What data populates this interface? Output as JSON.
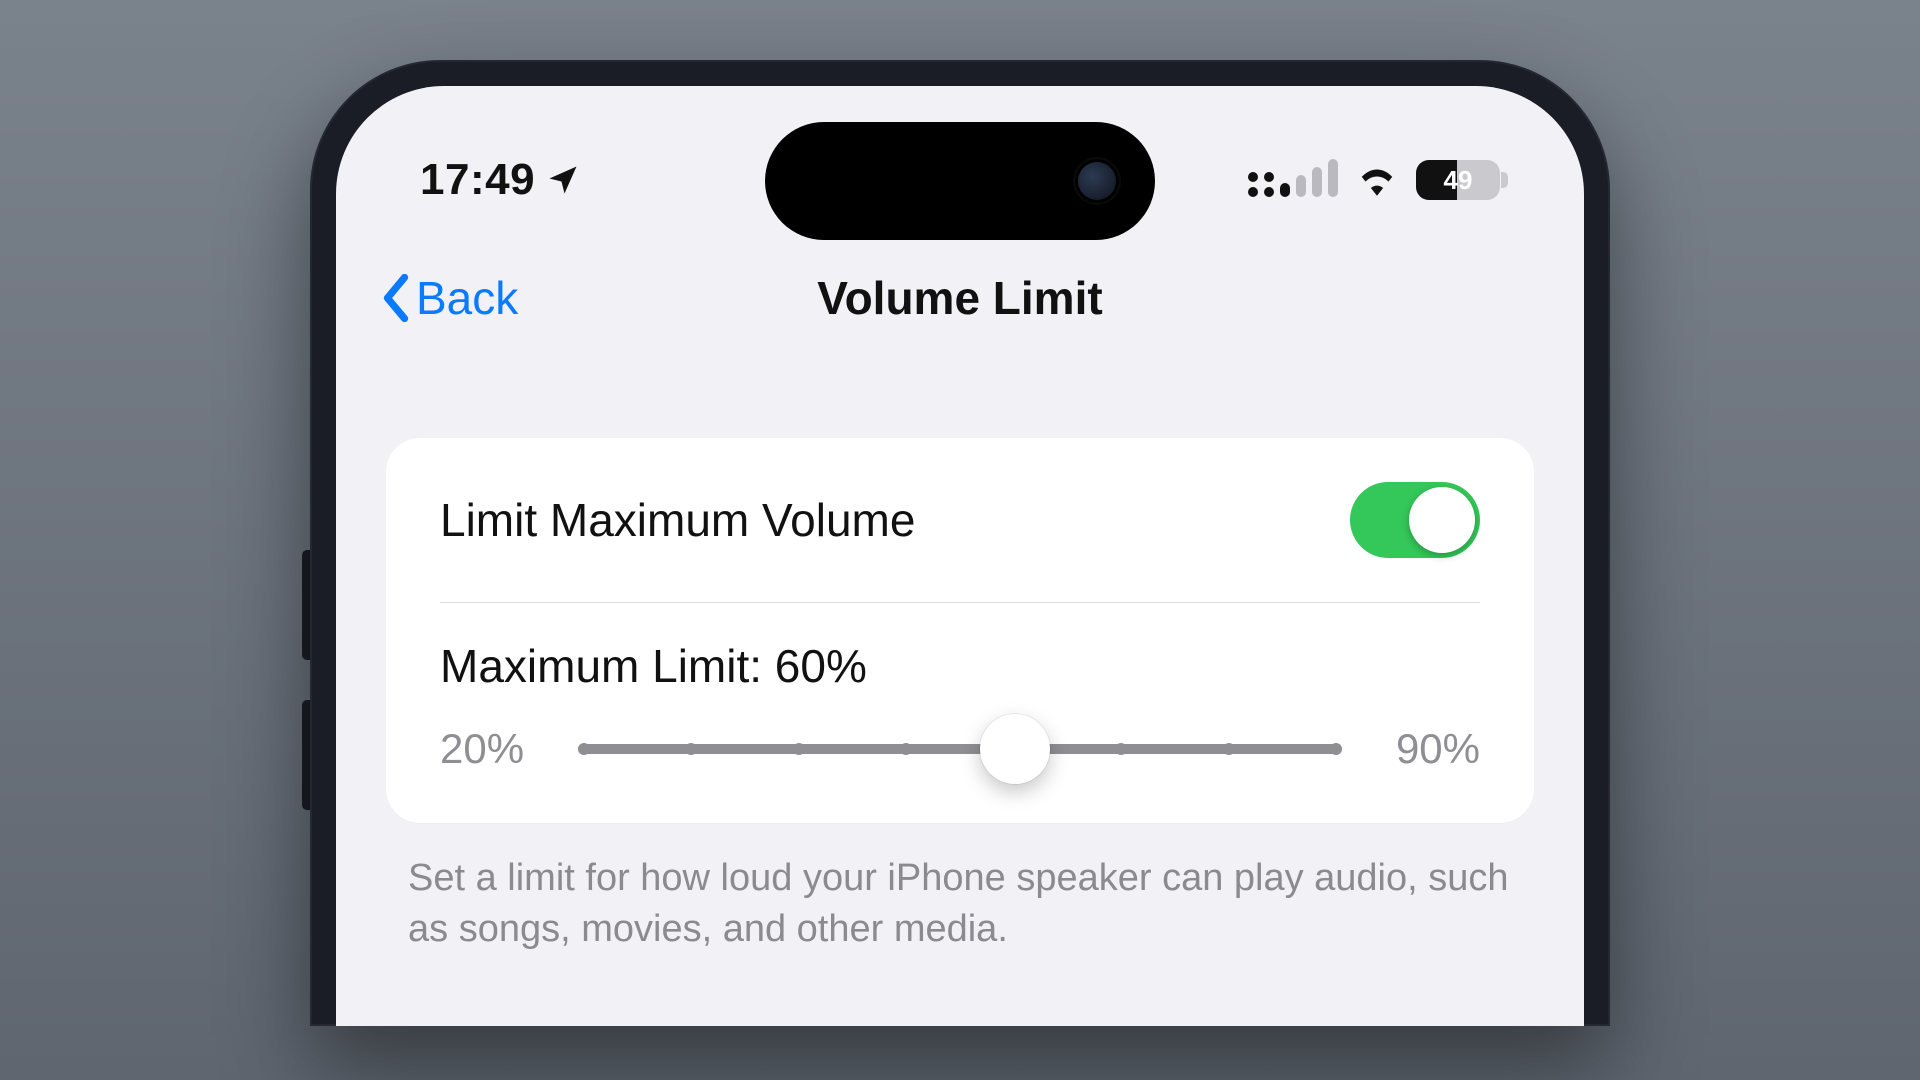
{
  "statusBar": {
    "time": "17:49",
    "batteryPercent": 49,
    "batteryFillPct": 49
  },
  "nav": {
    "backLabel": "Back",
    "title": "Volume Limit"
  },
  "settings": {
    "toggleLabel": "Limit Maximum Volume",
    "toggleOn": true,
    "limitLabel": "Maximum Limit: 60%",
    "sliderMinLabel": "20%",
    "sliderMaxLabel": "90%",
    "sliderMin": 20,
    "sliderMax": 90,
    "sliderValue": 60,
    "tickCount": 8,
    "footer": "Set a limit for how loud your iPhone speaker can play audio, such as songs, movies, and other media."
  },
  "colors": {
    "accentBlue": "#0a7aff",
    "toggleGreen": "#34c759"
  }
}
